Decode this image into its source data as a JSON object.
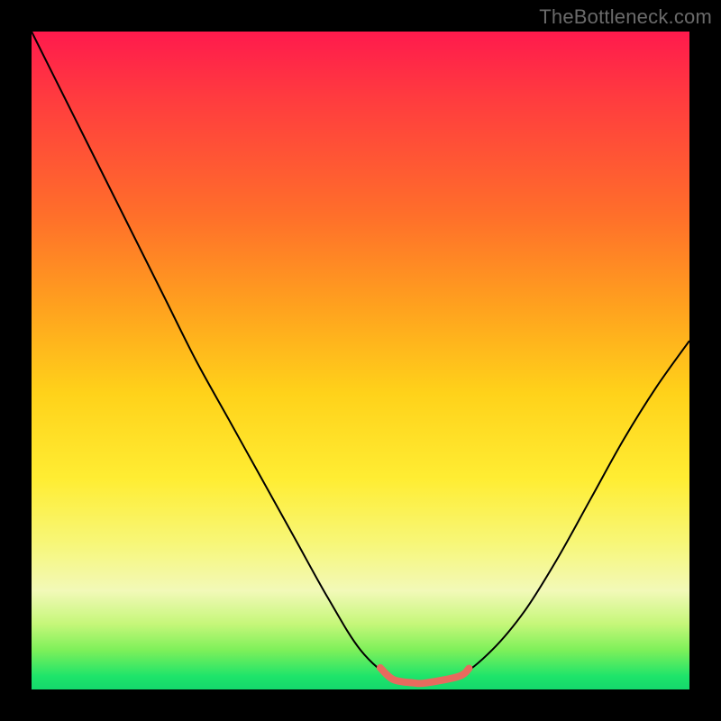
{
  "watermark": {
    "text": "TheBottleneck.com"
  },
  "palette": {
    "black": "#000000",
    "curve_stroke": "#000000",
    "coral": "#e86a5e"
  },
  "chart_data": {
    "type": "line",
    "title": "",
    "xlabel": "",
    "ylabel": "",
    "xlim": [
      0,
      1
    ],
    "ylim": [
      0,
      1
    ],
    "x": [
      0.0,
      0.05,
      0.1,
      0.15,
      0.2,
      0.25,
      0.3,
      0.35,
      0.4,
      0.45,
      0.5,
      0.55,
      0.58,
      0.6,
      0.65,
      0.7,
      0.75,
      0.8,
      0.85,
      0.9,
      0.95,
      1.0
    ],
    "series": [
      {
        "name": "bottleneck_curve",
        "values": [
          1.0,
          0.9,
          0.8,
          0.7,
          0.6,
          0.5,
          0.41,
          0.32,
          0.23,
          0.14,
          0.06,
          0.015,
          0.01,
          0.01,
          0.02,
          0.06,
          0.12,
          0.2,
          0.29,
          0.38,
          0.46,
          0.53
        ]
      }
    ],
    "highlight_segment": {
      "x_start": 0.53,
      "x_end": 0.665,
      "color": "#e86a5e"
    }
  }
}
